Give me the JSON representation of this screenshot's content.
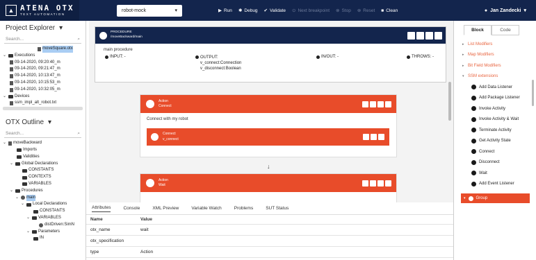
{
  "logo": {
    "title": "ATENA OTX",
    "subtitle": "TEXT AUTOMATION"
  },
  "toolbar": {
    "project": "robot-mock",
    "run": "Run",
    "debug": "Debug",
    "validate": "Validate",
    "next_breakpoint": "Next breakpoint",
    "stop": "Stop",
    "reset": "Reset",
    "clean": "Clean",
    "user": "Jan Zandecki"
  },
  "explorer": {
    "title": "Project Explorer",
    "search": "Search...",
    "items": [
      {
        "label": "moveSquare.otx",
        "indent": 52,
        "kind": "file",
        "selected": true
      },
      {
        "label": "Executions",
        "indent": 4,
        "kind": "folder",
        "caret": "v"
      },
      {
        "label": "09-14-2020, 09:20:40_m",
        "indent": 12,
        "kind": "file"
      },
      {
        "label": "09-14-2020, 09:21:47_m",
        "indent": 12,
        "kind": "file"
      },
      {
        "label": "09-14-2020, 10:13:47_m",
        "indent": 12,
        "kind": "file"
      },
      {
        "label": "09-14-2020, 10:15:53_m",
        "indent": 12,
        "kind": "file"
      },
      {
        "label": "09-14-2020, 10:32:05_m",
        "indent": 12,
        "kind": "file"
      },
      {
        "label": "Devices",
        "indent": 4,
        "kind": "folder",
        "caret": "v"
      },
      {
        "label": "ssm_impl_alt_robot.txt",
        "indent": 12,
        "kind": "file"
      }
    ]
  },
  "outline": {
    "title": "OTX Outline",
    "search": "Search...",
    "items": [
      {
        "label": "moveBackward",
        "indent": 4,
        "kind": "file",
        "caret": "v"
      },
      {
        "label": "Imports",
        "indent": 22,
        "kind": "folder"
      },
      {
        "label": "Validities",
        "indent": 22,
        "kind": "folder"
      },
      {
        "label": "Global Declarations",
        "indent": 14,
        "kind": "folder",
        "caret": "v"
      },
      {
        "label": "CONSTANTS",
        "indent": 30,
        "kind": "folder"
      },
      {
        "label": "CONTEXTS",
        "indent": 30,
        "kind": "folder"
      },
      {
        "label": "VARIABLES",
        "indent": 30,
        "kind": "folder"
      },
      {
        "label": "Procedures",
        "indent": 14,
        "kind": "folder",
        "caret": "v"
      },
      {
        "label": "main",
        "indent": 22,
        "kind": "proc",
        "caret": "v",
        "selected": true
      },
      {
        "label": "Local Declarations",
        "indent": 30,
        "kind": "folder",
        "caret": "v"
      },
      {
        "label": "CONSTANTS",
        "indent": 46,
        "kind": "folder"
      },
      {
        "label": "VARIABLES",
        "indent": 38,
        "kind": "folder",
        "caret": "v"
      },
      {
        "label": "distDriven:SimN",
        "indent": 54,
        "kind": "proc"
      },
      {
        "label": "Parameters",
        "indent": 38,
        "kind": "folder",
        "caret": "v"
      },
      {
        "label": "IN",
        "indent": 46,
        "kind": "folder"
      }
    ]
  },
  "procedure": {
    "kind": "PROCEDURE",
    "path": "/moveBackward/main",
    "name": "main procedure",
    "input": "INPUT: -",
    "output": "OUTPUT:",
    "output_items": [
      "v_connect:Connection",
      "v_disconnect:Boolean"
    ],
    "inout": "IN/OUT: -",
    "throws": "THROWS: -"
  },
  "actions": [
    {
      "kind": "Action",
      "name": "Connect",
      "body": "Connect with my robot",
      "inner_kind": "Connect",
      "inner_name": "v_connect"
    },
    {
      "kind": "Action",
      "name": "Wait"
    }
  ],
  "bottom_tabs": [
    "Attributes",
    "Console",
    "XML Preview",
    "Variable Watch",
    "Problems",
    "SUT Status"
  ],
  "attributes": {
    "headers": [
      "Name",
      "Value"
    ],
    "rows": [
      [
        "otx_name",
        "wait"
      ],
      [
        "otx_specification",
        ""
      ],
      [
        "type",
        "Action"
      ]
    ]
  },
  "palette": {
    "tabs": [
      "Block",
      "Code"
    ],
    "categories": [
      "List Modifiers",
      "Map Modifiers",
      "Bit Field Modifiers",
      "SSM extensions"
    ],
    "blocks": [
      "Add Data Listener",
      "Add Package Listener",
      "Invoke Activity",
      "Invoke Activity & Wait",
      "Terminate Activity",
      "Get Activity State",
      "Connect",
      "Disconnect",
      "Wait",
      "Add Event Listener"
    ],
    "group": "Group"
  },
  "colors": {
    "navy": "#13254d",
    "accent": "#e84c2a"
  }
}
